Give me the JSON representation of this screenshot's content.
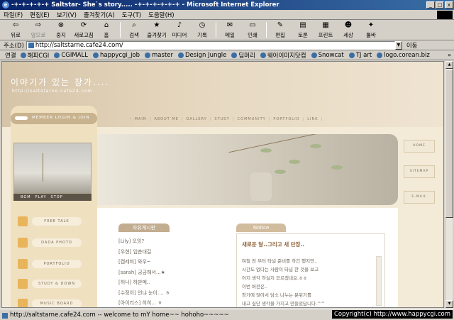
{
  "window": {
    "title": "-+-+-+-+-+ Saltstar- She`s story..... -+-+-+-+-+-+ - Microsoft Internet Explorer"
  },
  "menu": [
    "파일(F)",
    "편집(E)",
    "보기(V)",
    "즐겨찾기(A)",
    "도구(T)",
    "도움말(H)"
  ],
  "toolbar": {
    "back": "뒤로",
    "forward": "앞으로",
    "stop": "중지",
    "refresh": "새로고침",
    "home": "홈",
    "search": "검색",
    "favorites": "즐겨찾기",
    "media": "미디어",
    "history": "기록",
    "mail": "메일",
    "print": "인쇄",
    "edit": "편집",
    "discuss": "토론",
    "print2": "프린트",
    "messenger": "세상",
    "tools": "툴바"
  },
  "address": {
    "label": "주소(D)",
    "url": "http://saltstarne.cafe24.com/",
    "go": "이동"
  },
  "links": {
    "label": "연결",
    "items": [
      "해피CGI",
      "CGIMALL",
      "happycgi_job",
      "master",
      "Design Jungle",
      "딤머리",
      "웨어이미지닷컴",
      "Snowcat",
      "TJ art",
      "logo.corean.biz"
    ],
    "more": "»"
  },
  "site": {
    "title": "이야기가 있는 창가....",
    "url": "http://saltstarne.cafe24.com",
    "login": "MEMBER LOGIN & JOIN",
    "nav": [
      "MAIN",
      "ABOUT ME",
      "GALLERY",
      "STUDY",
      "COMMUNITY",
      "PORTFOLIO",
      "LINK"
    ],
    "media": [
      "BGM",
      "PLAY",
      "STOP"
    ],
    "side_menu": [
      "FREE TALK",
      "DADA PHOTO",
      "PORTFOLIO",
      "STUDY & DOWN",
      "MUSIC BOARD"
    ],
    "right_tabs": [
      "HOME",
      "SITEMAP",
      "E-MAIL"
    ],
    "board_title": "자유게시판",
    "board_rows": [
      "[Lily] 오잉?",
      "[우현] 입춘대길",
      "[캡레비] 와우~",
      "[sarah] 궁금해서...★",
      "[허니] 하받메..",
      "[수정이] 언냐 눈이.... ㅎ",
      "[아이리스] 히히... ㅎ"
    ],
    "notice_title": "Notice",
    "notice_heading": "새로운 달..그리고 새 단장..",
    "notice_lines": [
      "며칠 전 부터 타널 준비를 하긴 했지만..",
      "시간도 없다는 사람이 타널 한 것을 보고",
      "어지 생각 하실지 모르겠네요.ㅎㅎ",
      "이번 버전은..",
      "창가에 앉아서 담소 나누는 분위기를",
      "내고 싶단 생각을 가지고 만들었답니다.^^"
    ]
  },
  "status": {
    "text": "http://saltstarne.cafe24.com -- welcome to mY home~~ hohoho~~~~~",
    "copyright": "Copyright(c) http://www.happycgi.com"
  }
}
